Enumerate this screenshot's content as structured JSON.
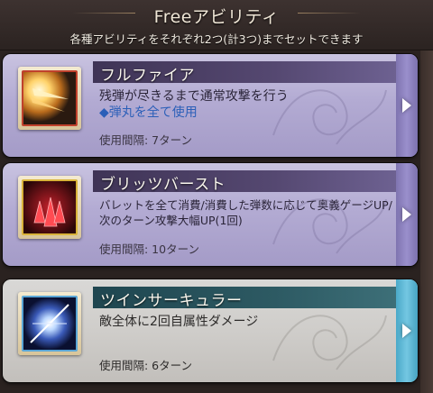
{
  "header": {
    "title": "Freeアビリティ",
    "subtitle": "各種アビリティをそれぞれ2つ(計3つ)までセットできます"
  },
  "abilities": [
    {
      "name": "フルファイア",
      "description": "残弾が尽きるまで通常攻撃を行う",
      "sub_description": "◆弾丸を全て使用",
      "cooldown": "使用間隔: 7ターン",
      "icon": "muzzle-flash-icon",
      "theme": "purple"
    },
    {
      "name": "ブリッツバースト",
      "description": "バレットを全て消費/消費した弾数に応じて奥義ゲージUP/次のターン攻撃大幅UP(1回)",
      "cooldown": "使用間隔: 10ターン",
      "icon": "bullets-icon",
      "theme": "purple"
    },
    {
      "name": "ツインサーキュラー",
      "description": "敵全体に2回自属性ダメージ",
      "cooldown": "使用間隔: 6ターン",
      "icon": "light-burst-icon",
      "theme": "teal"
    }
  ]
}
